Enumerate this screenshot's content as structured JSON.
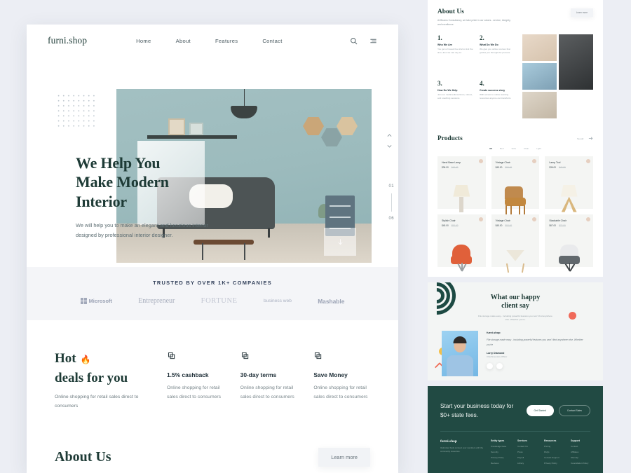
{
  "nav": {
    "brand": "furni.shop",
    "links": [
      "Home",
      "About",
      "Features",
      "Contact"
    ],
    "search_icon": "search-icon",
    "menu_icon": "menu-icon"
  },
  "hero": {
    "heading_line1": "We Help You",
    "heading_line2": "Make Modern",
    "heading_line3": "Interior",
    "paragraph": "We will help you to make an elegant and luxurious interior designed by professional interior designer.",
    "slide_current": "01",
    "slide_total": "06",
    "up_icon": "chevron-up-icon",
    "down_icon": "chevron-down-icon",
    "download_icon": "arrow-down-icon"
  },
  "trusted": {
    "title": "TRUSTED BY OVER 1K+ COMPANIES",
    "logos": [
      "Microsoft",
      "Entrepreneur",
      "FORTUNE",
      "business web",
      "Mashable"
    ]
  },
  "deals": {
    "heading_line1": "Hot",
    "heading_line2": "deals for you",
    "fire_icon": "fire-icon",
    "subtitle": "Online shopping for retail sales direct to consumers",
    "items": [
      {
        "title": "1.5% cashback",
        "desc": "Online shopping for retail sales direct to consumers",
        "icon": "layers-icon"
      },
      {
        "title": "30-day terms",
        "desc": "Online shopping for retail sales direct to consumers",
        "icon": "layers-icon"
      },
      {
        "title": "Save Money",
        "desc": "Online shopping for retail sales direct to consumers",
        "icon": "layers-icon"
      }
    ]
  },
  "about_bottom": {
    "heading": "About Us",
    "button": "Learn more"
  },
  "about": {
    "heading": "About Us",
    "subtitle": "At Beams Consultancy, we take pride in our values - service, integrity, and excellence.",
    "button": "Learn more",
    "items": [
      {
        "num": "1.",
        "title": "Who We Are",
        "desc": "You get a 3 week free trial to kick the tires, then we can say so."
      },
      {
        "num": "2.",
        "title": "What Do We Do",
        "desc": "We give you online courses that guides you through the process."
      },
      {
        "num": "3.",
        "title": "How Do We Help",
        "desc": "Join our multimedia lectures, videos, and coaching sessions."
      },
      {
        "num": "4.",
        "title": "Create success story",
        "desc": "With access to online learning resources anyone can transform."
      }
    ]
  },
  "products": {
    "heading": "Products",
    "see_all": "See all",
    "arrow_icon": "arrow-right-icon",
    "tabs": [
      "All",
      "Bed",
      "Sofa",
      "Chair",
      "Light"
    ],
    "active_tab": "All",
    "items": [
      {
        "name": "Hand Base Lamp",
        "price": "$36.00",
        "old_price": "$42.00",
        "type": "lamp"
      },
      {
        "name": "Vintage Chair",
        "price": "$45.00",
        "old_price": "$52.00",
        "type": "wood-chair"
      },
      {
        "name": "Lamp Tool",
        "price": "$36.00",
        "old_price": "$42.00",
        "type": "tripod-lamp"
      },
      {
        "name": "Stylish Chair",
        "price": "$45.00",
        "old_price": "$52.00",
        "type": "orange-chair"
      },
      {
        "name": "Vintage Chair",
        "price": "$45.00",
        "old_price": "$52.00",
        "type": "cone-chair"
      },
      {
        "name": "Stackable Chair",
        "price": "$67.00",
        "old_price": "$72.00",
        "type": "grey-chair"
      }
    ]
  },
  "testimonial": {
    "heading_line1": "What our happy",
    "heading_line2": "client say",
    "subtitle": "File storage made easy - including powerful features you won't find anywhere else. Whether you're.",
    "brand": "furni.shop",
    "quote": "File storage made easy - including powerful features you won't find anywhere else. Whether you're",
    "author": "Larry Diamond",
    "role": "Chief Executive Officer",
    "prev_icon": "chevron-left-icon",
    "next_icon": "chevron-right-icon"
  },
  "cta": {
    "heading_line1": "Start your business today for",
    "heading_line2": "$0+ state fees.",
    "primary_button": "Get Started",
    "secondary_button": "Contact Sales"
  },
  "footer": {
    "brand": "furni.shop",
    "desc": "Optimized body connect your members with the community resources.",
    "columns": [
      {
        "title": "Entity types",
        "links": [
          "Knowledge base",
          "Security",
          "Privacy Policy",
          "Reviews"
        ]
      },
      {
        "title": "Services",
        "links": [
          "Contact Us",
          "Press",
          "Payroll",
          "Library"
        ]
      },
      {
        "title": "Resources",
        "links": [
          "Pricing",
          "FAQs",
          "Contact Support",
          "Privacy Policy"
        ]
      },
      {
        "title": "Support",
        "links": [
          "Contact",
          "Affiliates",
          "Sitemap",
          "Cancellation Policy"
        ]
      }
    ]
  },
  "colors": {
    "dark_green": "#1e3b36",
    "cta_green": "#214a43",
    "hero_teal": "#9cbbbd",
    "page_bg": "#eceef4"
  }
}
